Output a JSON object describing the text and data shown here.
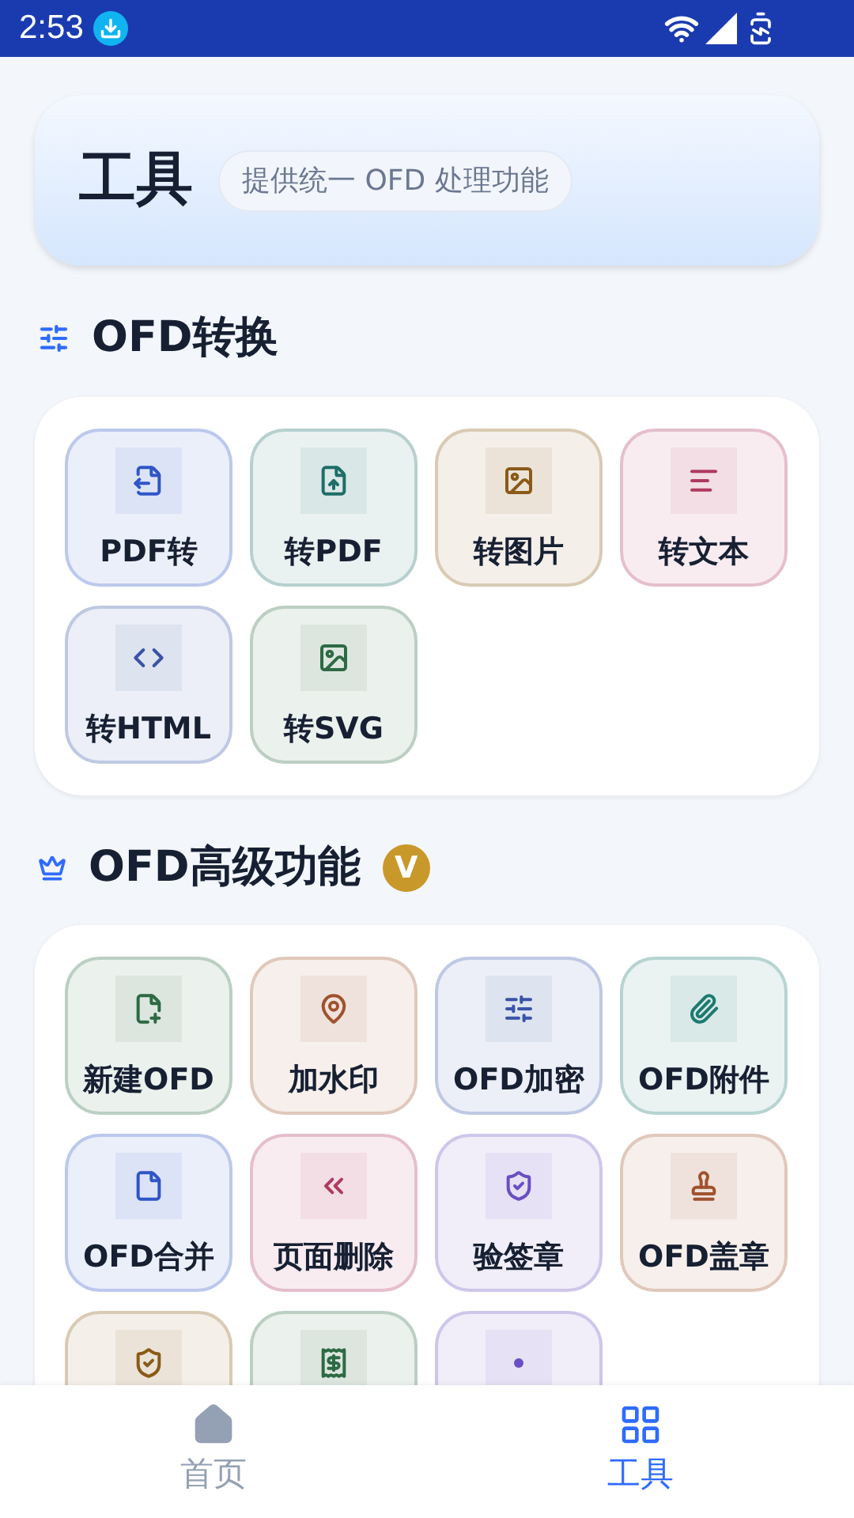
{
  "status_bar": {
    "time": "2:53"
  },
  "header": {
    "title": "工具",
    "subtitle": "提供统一 OFD 处理功能"
  },
  "sections": [
    {
      "title": "OFD转换",
      "kind": "convert",
      "tools": [
        {
          "label": "PDF转",
          "color": "#2f55c8"
        },
        {
          "label": "转PDF",
          "color": "#1d6e68"
        },
        {
          "label": "转图片",
          "color": "#8a5a17"
        },
        {
          "label": "转文本",
          "color": "#b03a5f"
        },
        {
          "label": "转HTML",
          "color": "#3a53a8"
        },
        {
          "label": "转SVG",
          "color": "#2d6a44"
        }
      ]
    },
    {
      "title": "OFD高级功能",
      "kind": "advanced",
      "badge": "V",
      "tools": [
        {
          "label": "新建OFD",
          "color": "#2d6a44"
        },
        {
          "label": "加水印",
          "color": "#a0522d"
        },
        {
          "label": "OFD加密",
          "color": "#3a53a8"
        },
        {
          "label": "OFD附件",
          "color": "#1d7a70"
        },
        {
          "label": "OFD合并",
          "color": "#2f55c8"
        },
        {
          "label": "页面删除",
          "color": "#b03a5f"
        },
        {
          "label": "验签章",
          "color": "#6a4fc4"
        },
        {
          "label": "OFD盖章",
          "color": "#a0522d"
        },
        {
          "color": "#8a5a17"
        },
        {
          "color": "#2d6a44"
        },
        {
          "color": "#6a4fc4"
        }
      ]
    }
  ],
  "nav": [
    {
      "label": "首页",
      "selected": false
    },
    {
      "label": "工具",
      "selected": true
    }
  ]
}
